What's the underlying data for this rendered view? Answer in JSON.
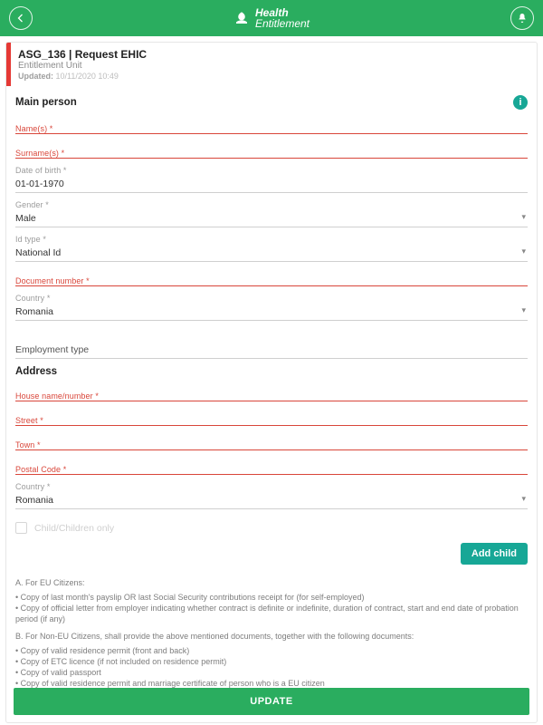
{
  "brand": {
    "line1": "Health",
    "line2": "Entitlement"
  },
  "header": {
    "title": "ASG_136 | Request EHIC",
    "subtitle": "Entitlement Unit",
    "updated_label": "Updated:",
    "updated_value": "10/11/2020 10:49"
  },
  "section_main": {
    "title": "Main person"
  },
  "fields": {
    "names": {
      "label": "Name(s) *"
    },
    "surnames": {
      "label": "Surname(s) *"
    },
    "dob": {
      "label": "Date of birth *",
      "value": "01-01-1970"
    },
    "gender": {
      "label": "Gender *",
      "value": "Male"
    },
    "idtype": {
      "label": "Id type *",
      "value": "National Id"
    },
    "docnum": {
      "label": "Document number *"
    },
    "country": {
      "label": "Country *",
      "value": "Romania"
    },
    "emptype": {
      "label": "Employment type"
    }
  },
  "section_addr": {
    "title": "Address"
  },
  "addr": {
    "house": {
      "label": "House name/number *"
    },
    "street": {
      "label": "Street *"
    },
    "town": {
      "label": "Town *"
    },
    "postal": {
      "label": "Postal Code *"
    },
    "country": {
      "label": "Country *",
      "value": "Romania"
    }
  },
  "children_checkbox": "Child/Children only",
  "add_child": "Add child",
  "notes": {
    "a_head": "A. For EU Citizens:",
    "a": [
      "Copy of last month's payslip OR last Social Security contributions receipt for (for self-employed)",
      "Copy of official letter from employer indicating whether contract is definite or indefinite, duration of contract, start and end date of probation period (if any)"
    ],
    "b_head": "B. For Non-EU Citizens, shall provide the above mentioned documents, together with the following documents:",
    "b": [
      "Copy of valid residence permit (front and back)",
      "Copy of ETC licence (if not included on residence permit)",
      "Copy of valid passport",
      "Copy of valid residence permit and marriage certificate of person who is a EU citizen"
    ]
  },
  "update_btn": "UPDATE"
}
